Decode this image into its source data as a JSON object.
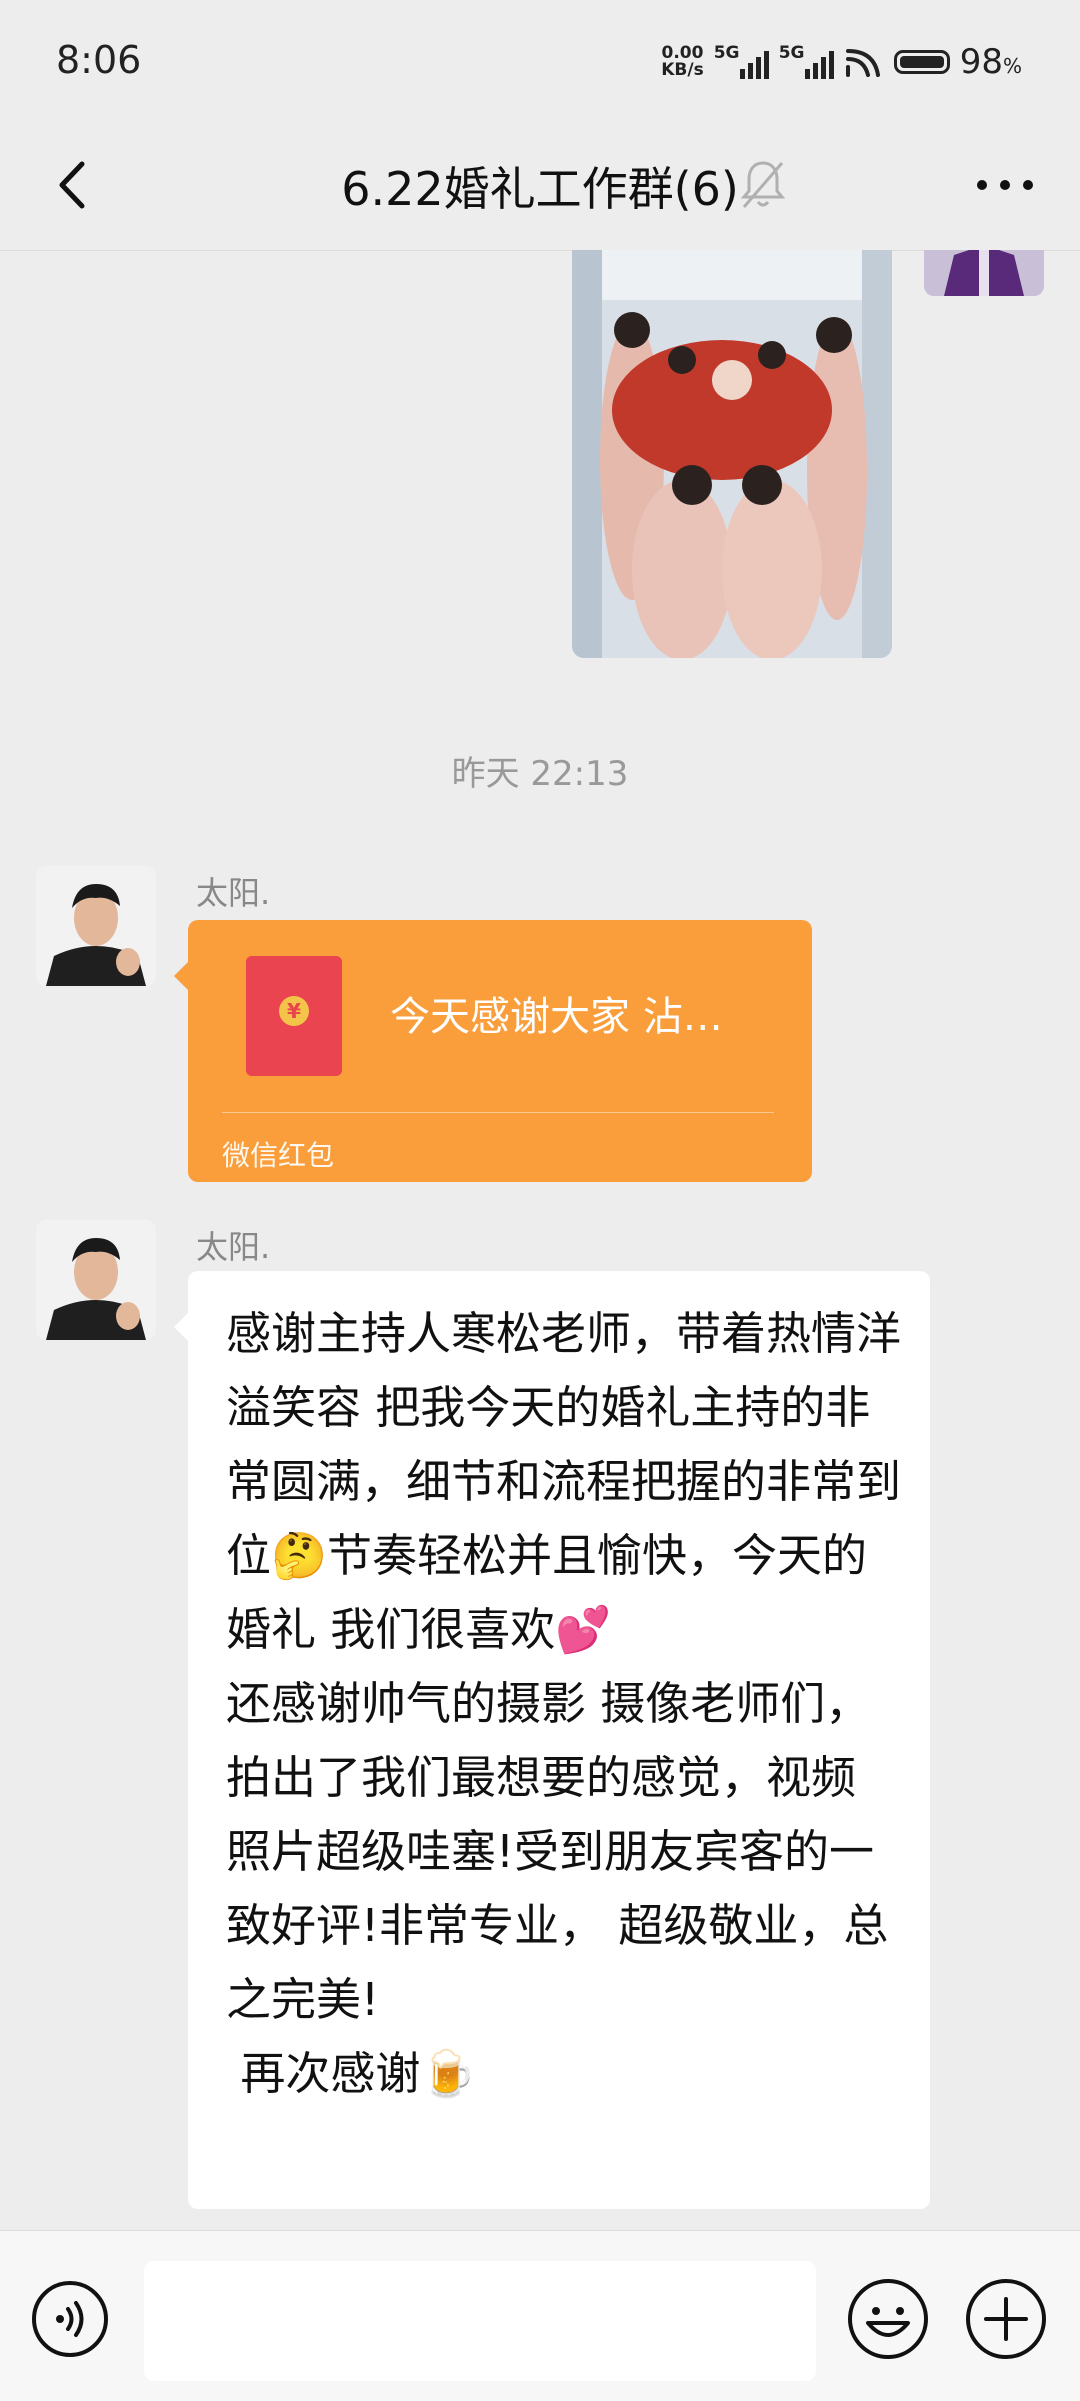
{
  "status_bar": {
    "time": "8:06",
    "net_speed_value": "0.00",
    "net_speed_unit": "KB/s",
    "signal1_label": "5G",
    "signal2_label": "5G",
    "battery_percent": "98",
    "battery_percent_sign": "%"
  },
  "header": {
    "title": "6.22婚礼工作群(6)",
    "back_icon": "chevron-left-icon",
    "mute_icon": "bell-muted-icon",
    "more_icon": "more-dots-icon"
  },
  "chat": {
    "timestamp": "昨天 22:13",
    "messages": [
      {
        "sender": "太阳.",
        "type": "red_packet",
        "text": "今天感谢大家 沾…",
        "label": "微信红包",
        "coin_symbol": "¥"
      },
      {
        "sender": "太阳.",
        "type": "text",
        "text": "感谢主持人寒松老师，带着热情洋溢笑容 把我今天的婚礼主持的非常圆满，细节和流程把握的非常到位🤔节奏轻松并且愉快，今天的婚礼 我们很喜欢💕\n还感谢帅气的摄影 摄像老师们，拍出了我们最想要的感觉，视频 照片超级哇塞!受到朋友宾客的一致好评!非常专业， 超级敬业，总之完美!\n 再次感谢🍺"
      }
    ]
  },
  "input_bar": {
    "voice_icon": "voice-icon",
    "emoji_icon": "emoji-icon",
    "plus_icon": "plus-icon"
  },
  "colors": {
    "background": "#ededed",
    "red_packet": "#fa9d3b",
    "envelope": "#e9444f",
    "bubble": "#ffffff"
  }
}
